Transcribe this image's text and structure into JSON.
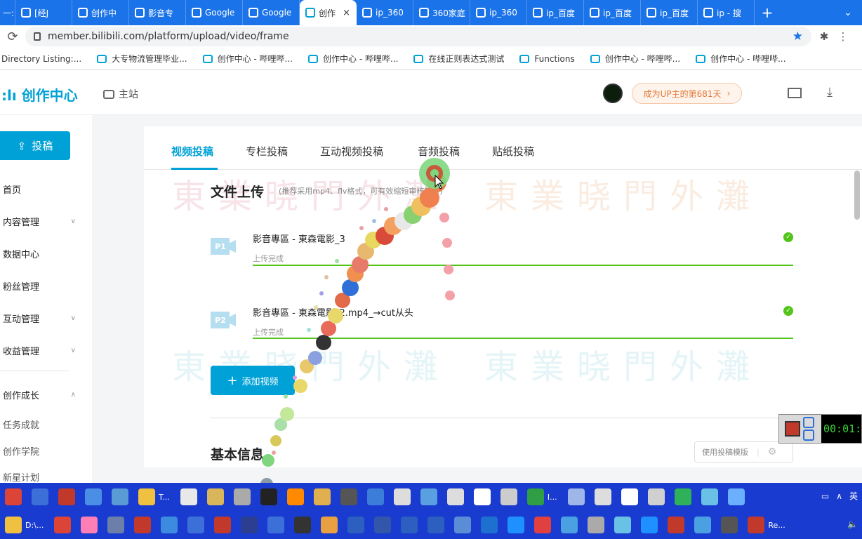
{
  "browser": {
    "tabs": [
      {
        "label": "一:",
        "active": false
      },
      {
        "label": "[经J",
        "active": false
      },
      {
        "label": "创作中",
        "active": false
      },
      {
        "label": "影音专",
        "active": false
      },
      {
        "label": "Google",
        "active": false
      },
      {
        "label": "Google",
        "active": false
      },
      {
        "label": "创作",
        "active": true
      },
      {
        "label": "ip_360",
        "active": false
      },
      {
        "label": "360家庭",
        "active": false
      },
      {
        "label": "ip_360",
        "active": false
      },
      {
        "label": "ip_百度",
        "active": false
      },
      {
        "label": "ip_百度",
        "active": false
      },
      {
        "label": "ip_百度",
        "active": false
      },
      {
        "label": "ip - 搜",
        "active": false
      }
    ],
    "close_glyph": "×",
    "new_tab_glyph": "+",
    "url": "member.bilibili.com/platform/upload/video/frame",
    "bookmarks": [
      "Directory Listing:...",
      "大专物流管理毕业...",
      "创作中心 - 哔哩哔...",
      "创作中心 - 哔哩哔...",
      "在线正则表达式测试",
      "Functions",
      "创作中心 - 哔哩哔...",
      "创作中心 - 哔哩哔..."
    ]
  },
  "header": {
    "logo": "创作中心",
    "main_site": "主站",
    "up_pill": "成为UP主的第681天"
  },
  "sidebar": {
    "post_button": "投稿",
    "items": [
      {
        "label": "首页",
        "chevron": ""
      },
      {
        "label": "内容管理",
        "chevron": "∨"
      },
      {
        "label": "数据中心",
        "chevron": ""
      },
      {
        "label": "粉丝管理",
        "chevron": ""
      },
      {
        "label": "互动管理",
        "chevron": "∨"
      },
      {
        "label": "收益管理",
        "chevron": "∨"
      },
      {
        "label": "创作成长",
        "chevron": "∧"
      }
    ],
    "subitems": [
      "任务成就",
      "创作学院",
      "新星计划"
    ]
  },
  "upload": {
    "tabs": [
      "视频投稿",
      "专栏投稿",
      "互动视频投稿",
      "音频投稿",
      "贴纸投稿"
    ],
    "watermark": "東業晓門外灘",
    "file_section_title": "文件上传",
    "file_section_hint": "(推荐采用mp4、flv格式，可有效缩短审核耗时)",
    "files": [
      {
        "badge": "P1",
        "name": "影音專區 - 東森電影_3",
        "status": "上传完成",
        "progress": 1.0
      },
      {
        "badge": "P2",
        "name": "影音專區 - 東森電影_2.mp4_→cut从头",
        "status": "上传完成",
        "progress": 1.0
      }
    ],
    "add_button": "添加视频",
    "basic_info_title": "基本信息",
    "template_button": "使用投稿模版"
  },
  "recorder": {
    "time": "00:01:5"
  },
  "taskbar": {
    "row1_labels": [
      "T...",
      "I..."
    ],
    "row2_labels": [
      "D:\\...",
      "Re..."
    ],
    "ime": "英",
    "row1_icons": [
      {
        "name": "chrome-icon",
        "color": "#db4437"
      },
      {
        "name": "window-icon",
        "color": "#3d6fd8"
      },
      {
        "name": "media-icon",
        "color": "#c0392b"
      },
      {
        "name": "notes-icon",
        "color": "#4a8ee6"
      },
      {
        "name": "laptop-icon",
        "color": "#5a9bd6"
      },
      {
        "name": "folder-icon",
        "color": "#f0c040"
      },
      {
        "name": "document-icon",
        "color": "#e8e8e8"
      },
      {
        "name": "explorer-icon",
        "color": "#d9b65a"
      },
      {
        "name": "figure-icon",
        "color": "#aaaaaa"
      },
      {
        "name": "record-icon",
        "color": "#222222"
      },
      {
        "name": "search-icon",
        "color": "#ff8a00"
      },
      {
        "name": "file-icon",
        "color": "#e0b050"
      },
      {
        "name": "film-icon",
        "color": "#555555"
      },
      {
        "name": "paint-icon",
        "color": "#3b7dd8"
      },
      {
        "name": "triangle-icon",
        "color": "#dddddd"
      },
      {
        "name": "pen-icon",
        "color": "#5aa0e0"
      },
      {
        "name": "triangle2-icon",
        "color": "#dddddd"
      },
      {
        "name": "7zip-icon",
        "color": "#ffffff"
      },
      {
        "name": "editor-icon",
        "color": "#cccccc"
      },
      {
        "name": "globe-icon",
        "color": "#2f9e44"
      },
      {
        "name": "app-icon",
        "color": "#9fb6e8"
      },
      {
        "name": "triangle3-icon",
        "color": "#dddddd"
      },
      {
        "name": "calendar-icon",
        "color": "#ffffff"
      },
      {
        "name": "layers-icon",
        "color": "#d0d0d0"
      },
      {
        "name": "vpn-icon",
        "color": "#2fb15a"
      },
      {
        "name": "settings-icon",
        "color": "#6ac1e6"
      },
      {
        "name": "send-icon",
        "color": "#6ab0ff"
      }
    ],
    "row2_icons": [
      {
        "name": "folder-icon",
        "color": "#f0c040"
      },
      {
        "name": "chrome-icon",
        "color": "#db4437"
      },
      {
        "name": "bilibili-icon",
        "color": "#ff7eb6"
      },
      {
        "name": "book-icon",
        "color": "#6b7fa8"
      },
      {
        "name": "media-icon",
        "color": "#c0392b"
      },
      {
        "name": "k-icon",
        "color": "#3d8be0"
      },
      {
        "name": "pe-icon",
        "color": "#3d6fd8"
      },
      {
        "name": "bomb-icon",
        "color": "#c0392b"
      },
      {
        "name": "pb-icon",
        "color": "#2c3e8f"
      },
      {
        "name": "pe2-icon",
        "color": "#3d6fd8"
      },
      {
        "name": "terminal-icon",
        "color": "#333333"
      },
      {
        "name": "grid-icon",
        "color": "#e8a040"
      },
      {
        "name": "exe-icon",
        "color": "#2c5fc0"
      },
      {
        "name": "runner-icon",
        "color": "#3355aa"
      },
      {
        "name": "cursor-icon",
        "color": "#2c5fc0"
      },
      {
        "name": "font-icon",
        "color": "#2c5fc0"
      },
      {
        "name": "screen-icon",
        "color": "#5b8dd6"
      },
      {
        "name": "window2-icon",
        "color": "#1d6fd0"
      },
      {
        "name": "ie-icon",
        "color": "#1e90ff"
      },
      {
        "name": "arrow-icon",
        "color": "#e04040"
      },
      {
        "name": "monitor-icon",
        "color": "#4aa0e0"
      },
      {
        "name": "user-icon",
        "color": "#aaaaaa"
      },
      {
        "name": "cloud-icon",
        "color": "#6ac1e6"
      },
      {
        "name": "ie2-icon",
        "color": "#1e90ff"
      },
      {
        "name": "game-icon",
        "color": "#c0392b"
      },
      {
        "name": "eye-icon",
        "color": "#4aa0e0"
      },
      {
        "name": "lens-icon",
        "color": "#555555"
      },
      {
        "name": "bug-icon",
        "color": "#c0392b"
      }
    ]
  }
}
